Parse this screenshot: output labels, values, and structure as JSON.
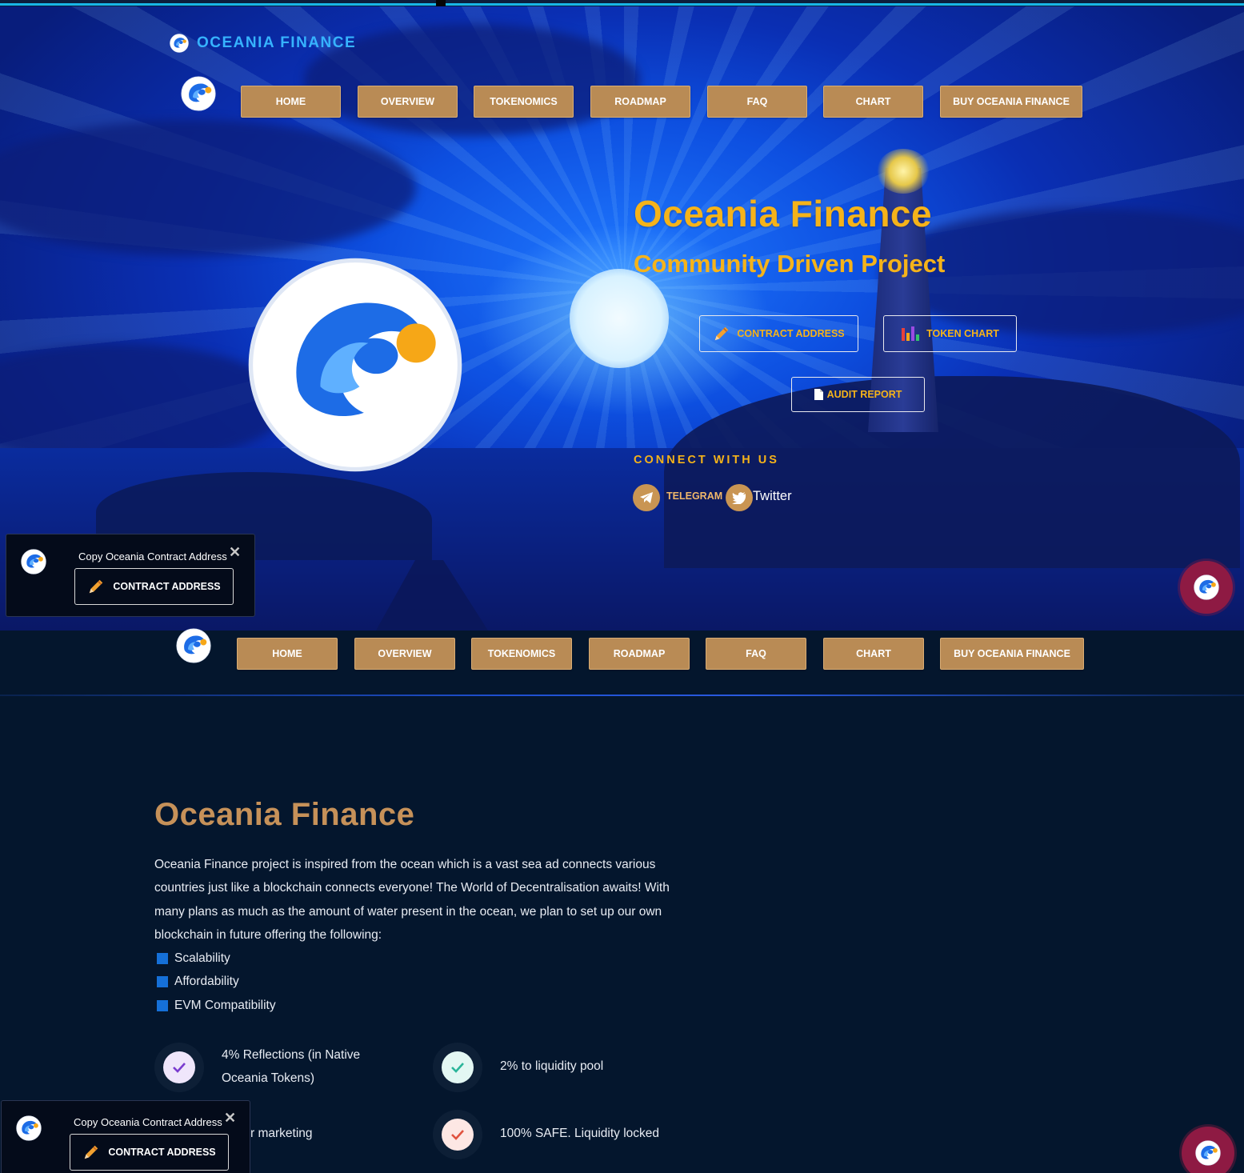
{
  "brand": {
    "name": "OCEANIA FINANCE"
  },
  "nav": {
    "items": [
      {
        "label": "HOME"
      },
      {
        "label": "OVERVIEW"
      },
      {
        "label": "TOKENOMICS"
      },
      {
        "label": "ROADMAP"
      },
      {
        "label": "FAQ"
      },
      {
        "label": "CHART"
      },
      {
        "label": "BUY OCEANIA FINANCE"
      }
    ]
  },
  "hero": {
    "title": "Oceania Finance",
    "subtitle": "Community Driven Project",
    "buttons": {
      "contract": "CONTRACT ADDRESS",
      "chart": "TOKEN CHART",
      "audit": "AUDIT REPORT"
    },
    "connect_title": "CONNECT WITH US",
    "social": {
      "telegram": "TELEGRAM",
      "twitter": "Twitter"
    }
  },
  "popup": {
    "title": "Copy Oceania Contract Address",
    "button": "CONTRACT ADDRESS",
    "close": "✕"
  },
  "about": {
    "title": "Oceania Finance",
    "paragraph": "Oceania Finance project is inspired from the ocean which is a vast sea ad connects various countries just like a blockchain connects everyone! The World of Decentralisation awaits! With many plans as much as the amount of water present in the ocean, we plan to set up our own blockchain in future offering the following:",
    "list": [
      "Scalability",
      "Affordability",
      "EVM Compatibility"
    ],
    "features": [
      {
        "text": "4% Reflections (in Native Oceania Tokens)"
      },
      {
        "text": "2% to liquidity pool"
      },
      {
        "text": "r marketing"
      },
      {
        "text": "100% SAFE. Liquidity locked"
      }
    ]
  },
  "colors": {
    "accent": "#f5b31a",
    "nav_button": "#b98b55",
    "background_dark": "#04162d",
    "fab": "#8e1a43"
  }
}
